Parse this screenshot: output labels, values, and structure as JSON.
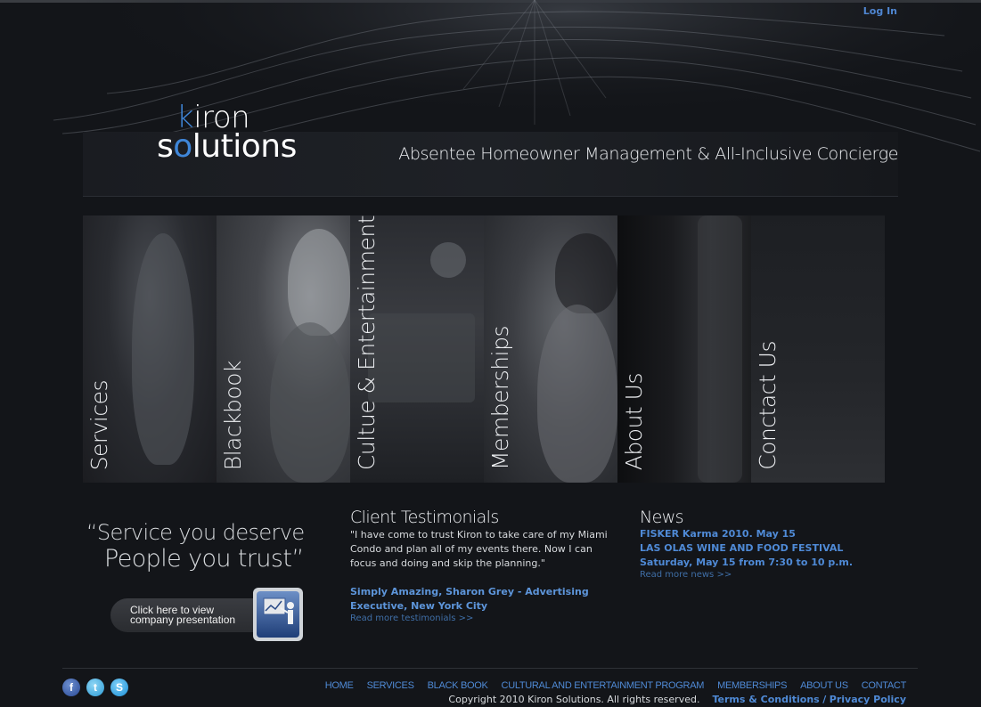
{
  "header": {
    "login": "Log In",
    "logo": {
      "line1_accent": "k",
      "line1_rest": "iron",
      "line2_start": "s",
      "line2_accent": "o",
      "line2_rest": "lutions"
    },
    "tagline": "Absentee Homeowner Management & All-Inclusive Concierge"
  },
  "panels": [
    {
      "label": "Services"
    },
    {
      "label": "Blackbook"
    },
    {
      "label": "Cultue & Entertainment"
    },
    {
      "label": "Memberships"
    },
    {
      "label": "About Us"
    },
    {
      "label": "Conctact Us"
    }
  ],
  "quote": {
    "line1": "“Service you deserve",
    "line2": "People you trust”"
  },
  "presentation": {
    "line1": "Click here to view",
    "line2": "company presentation"
  },
  "testimonials": {
    "title": "Client Testimonials",
    "body": "\"I have come to trust Kiron to take care of my Miami Condo and plan all of my events there. Now I can focus and doing and skip the planning.\"",
    "author": "Simply Amazing, Sharon Grey - Advertising Executive, New York City",
    "more": "Read more testimonials >>"
  },
  "news": {
    "title": "News",
    "items": [
      "FISKER Karma 2010. May 15",
      "LAS OLAS WINE AND FOOD FESTIVAL Saturday, May 15 from 7:30 to 10 p.m."
    ],
    "more": "Read more news >>"
  },
  "social": {
    "facebook_glyph": "f",
    "twitter_glyph": "t",
    "skype_glyph": "S"
  },
  "footer": {
    "nav": [
      "HOME",
      "SERVICES",
      "BLACK BOOK",
      "CULTURAL AND ENTERTAINMENT PROGRAM",
      "MEMBERSHIPS",
      "ABOUT US",
      "CONTACT"
    ],
    "copyright": "Copyright 2010 Kiron Solutions. All rights reserved.",
    "terms": "Terms & Conditions",
    "separator": "/",
    "privacy": "Privacy Policy"
  },
  "colors": {
    "background": "#131519",
    "accent": "#4f8ad6",
    "logo_accent": "#3f86d8"
  }
}
